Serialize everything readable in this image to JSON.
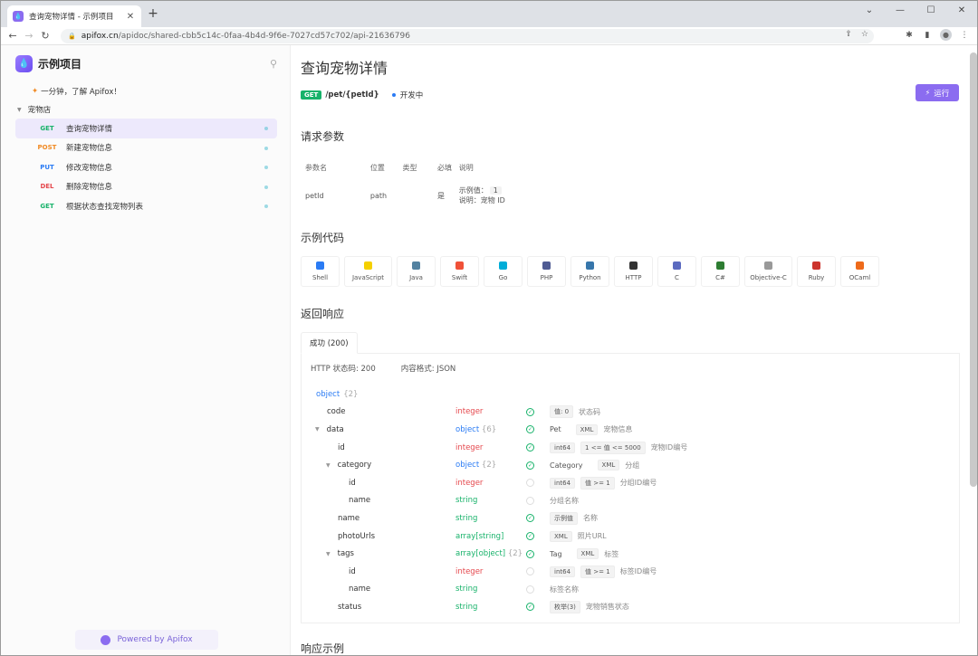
{
  "browser": {
    "tab_title": "查询宠物详情 - 示例项目",
    "url_host": "apifox.cn",
    "url_path": "/apidoc/shared-cbb5c14c-0faa-4b4d-9f6e-7027cd57c702/api-21636796"
  },
  "sidebar": {
    "project_name": "示例项目",
    "intro": "一分钟，了解 Apifox！",
    "folder": "宠物店",
    "items": [
      {
        "method": "GET",
        "label": "查询宠物详情"
      },
      {
        "method": "POST",
        "label": "新建宠物信息"
      },
      {
        "method": "PUT",
        "label": "修改宠物信息"
      },
      {
        "method": "DEL",
        "label": "删除宠物信息"
      },
      {
        "method": "GET",
        "label": "根据状态查找宠物列表"
      }
    ],
    "powered": "Powered by Apifox"
  },
  "main": {
    "title": "查询宠物详情",
    "method": "GET",
    "path": "/pet/{petId}",
    "status": "开发中",
    "run_label": "运行",
    "params_title": "请求参数",
    "params_headers": [
      "参数名",
      "位置",
      "类型",
      "必填",
      "说明"
    ],
    "params_row": {
      "name": "petId",
      "location": "path",
      "type": "",
      "required": "是",
      "example_label": "示例值：",
      "example_value": "1",
      "desc": "说明：宠物 ID"
    },
    "code_title": "示例代码",
    "code_langs": [
      "Shell",
      "JavaScript",
      "Java",
      "Swift",
      "Go",
      "PHP",
      "Python",
      "HTTP",
      "C",
      "C#",
      "Objective-C",
      "Ruby",
      "OCaml"
    ],
    "code_colors": [
      "#2a7bf4",
      "#f5d000",
      "#5382a1",
      "#f05138",
      "#00add8",
      "#4f5b93",
      "#3776ab",
      "#333333",
      "#5c6bc0",
      "#2e7d32",
      "#999999",
      "#cc342d",
      "#ee6a1a"
    ],
    "response_title": "返回响应",
    "response_tab": "成功 (200)",
    "http_status": "HTTP 状态码: 200",
    "content_format": "内容格式: JSON",
    "example_title": "响应示例"
  },
  "schema": {
    "root": "object",
    "root_count": "{2}",
    "rows": [
      {
        "name": "code",
        "type": "integer",
        "count": "",
        "required": true,
        "chips": [
          "值: 0"
        ],
        "desc": "状态码",
        "level": 1,
        "caret": false
      },
      {
        "name": "data",
        "type": "object",
        "count": "{6}",
        "required": true,
        "ref": "Pet",
        "chips": [
          "XML"
        ],
        "desc": "宠物信息",
        "level": 1,
        "caret": true
      },
      {
        "name": "id",
        "type": "integer",
        "count": "",
        "required": true,
        "chips": [
          "int64",
          "1 <= 值 <= 5000"
        ],
        "desc": "宠物ID编号",
        "level": 2,
        "caret": false
      },
      {
        "name": "category",
        "type": "object",
        "count": "{2}",
        "required": true,
        "ref": "Category",
        "chips": [
          "XML"
        ],
        "desc": "分组",
        "level": 2,
        "caret": true
      },
      {
        "name": "id",
        "type": "integer",
        "count": "",
        "required": false,
        "chips": [
          "int64",
          "值 >= 1"
        ],
        "desc": "分组ID编号",
        "level": 3,
        "caret": false
      },
      {
        "name": "name",
        "type": "string",
        "count": "",
        "required": false,
        "chips": [],
        "desc": "分组名称",
        "level": 3,
        "caret": false
      },
      {
        "name": "name",
        "type": "string",
        "count": "",
        "required": true,
        "chips": [
          "示例值"
        ],
        "desc": "名称",
        "level": 2,
        "caret": false
      },
      {
        "name": "photoUrls",
        "type": "array[string]",
        "count": "",
        "required": true,
        "chips": [
          "XML"
        ],
        "desc": "照片URL",
        "level": 2,
        "caret": false
      },
      {
        "name": "tags",
        "type": "array[object]",
        "count": "{2}",
        "required": true,
        "ref": "Tag",
        "chips": [
          "XML"
        ],
        "desc": "标签",
        "level": 2,
        "caret": true
      },
      {
        "name": "id",
        "type": "integer",
        "count": "",
        "required": false,
        "chips": [
          "int64",
          "值 >= 1"
        ],
        "desc": "标签ID编号",
        "level": 3,
        "caret": false
      },
      {
        "name": "name",
        "type": "string",
        "count": "",
        "required": false,
        "chips": [],
        "desc": "标签名称",
        "level": 3,
        "caret": false
      },
      {
        "name": "status",
        "type": "string",
        "count": "",
        "required": true,
        "chips": [
          "枚举(3)"
        ],
        "desc": "宠物销售状态",
        "level": 2,
        "caret": false
      }
    ]
  }
}
